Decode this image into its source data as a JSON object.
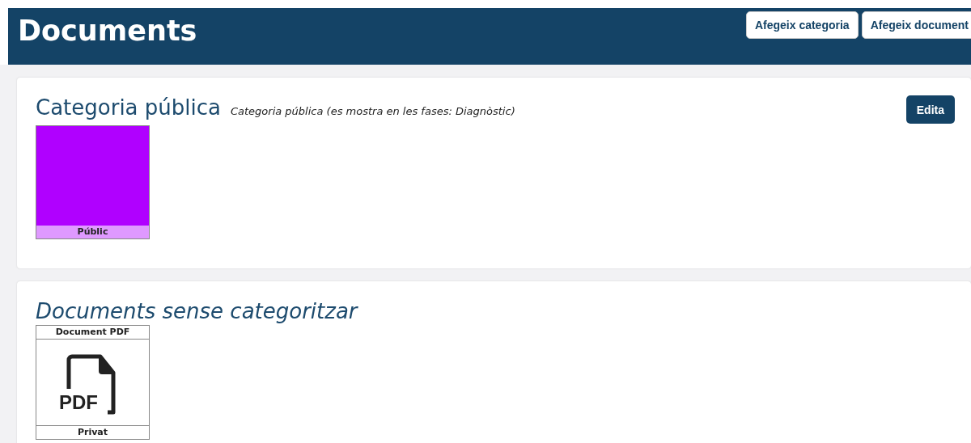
{
  "header": {
    "title": "Documents",
    "buttons": [
      "Afegeix categoria",
      "Afegeix document"
    ]
  },
  "categories": [
    {
      "title": "Categoria pública",
      "description": "Categoria pública (es mostra en les fases: Diagnòstic)",
      "edit_button": "Edita",
      "items": [
        {
          "kind": "color",
          "label": "Públic",
          "color": "#b000ff"
        }
      ]
    }
  ],
  "uncategorized": {
    "title": "Documents sense categoritzar",
    "items": [
      {
        "kind": "file",
        "name": "Document PDF",
        "icon_label": "PDF",
        "visibility": "Privat"
      }
    ]
  }
}
